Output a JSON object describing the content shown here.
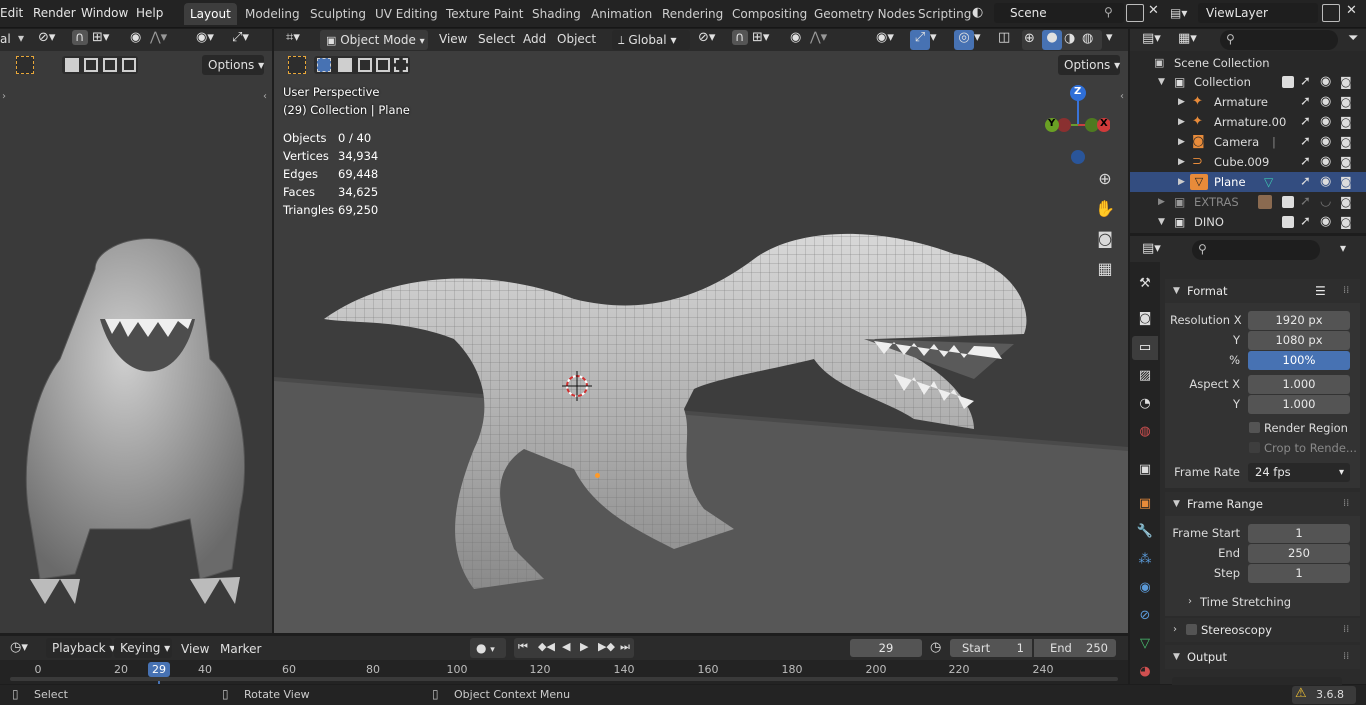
{
  "top_menu": {
    "edit": "Edit",
    "render": "Render",
    "window": "Window",
    "help": "Help"
  },
  "workspaces": [
    "Layout",
    "Modeling",
    "Sculpting",
    "UV Editing",
    "Texture Paint",
    "Shading",
    "Animation",
    "Rendering",
    "Compositing",
    "Geometry Nodes",
    "Scripting"
  ],
  "scene": {
    "name": "Scene",
    "view_layer": "ViewLayer"
  },
  "left_view": {
    "mode_frag": "al",
    "options": "Options"
  },
  "viewport": {
    "mode": "Object Mode",
    "view": "View",
    "select": "Select",
    "add": "Add",
    "object": "Object",
    "orientation": "Global",
    "options": "Options",
    "perspective": "User Perspective",
    "collection_line": "(29) Collection | Plane",
    "stats": [
      {
        "label": "Objects",
        "value": "0 / 40"
      },
      {
        "label": "Vertices",
        "value": "34,934"
      },
      {
        "label": "Edges",
        "value": "69,448"
      },
      {
        "label": "Faces",
        "value": "34,625"
      },
      {
        "label": "Triangles",
        "value": "69,250"
      }
    ],
    "gizmo": {
      "z": "Z",
      "y": "Y",
      "x": "X"
    }
  },
  "outliner": {
    "scene_collection": "Scene Collection",
    "rows": [
      {
        "name": "Collection",
        "level": 1
      },
      {
        "name": "Armature",
        "level": 2
      },
      {
        "name": "Armature.00",
        "level": 2
      },
      {
        "name": "Camera",
        "level": 2
      },
      {
        "name": "Cube.009",
        "level": 2
      },
      {
        "name": "Plane",
        "level": 2,
        "selected": true
      },
      {
        "name": "EXTRAS",
        "level": 1
      },
      {
        "name": "DINO",
        "level": 1
      }
    ]
  },
  "properties": {
    "format_title": "Format",
    "resolution_x_label": "Resolution X",
    "resolution_x": "1920 px",
    "y_label": "Y",
    "resolution_y": "1080 px",
    "pct_label": "%",
    "pct": "100%",
    "aspect_x_label": "Aspect X",
    "aspect_x": "1.000",
    "aspect_y_label": "Y",
    "aspect_y": "1.000",
    "render_region": "Render Region",
    "crop": "Crop to Rende...",
    "frame_rate_label": "Frame Rate",
    "frame_rate": "24 fps",
    "frame_range_title": "Frame Range",
    "frame_start_label": "Frame Start",
    "frame_start": "1",
    "end_label": "End",
    "end": "250",
    "step_label": "Step",
    "step": "1",
    "time_stretching": "Time Stretching",
    "stereoscopy": "Stereoscopy",
    "output": "Output"
  },
  "timeline": {
    "playback": "Playback",
    "keying": "Keying",
    "view": "View",
    "marker": "Marker",
    "current_frame": "29",
    "start_label": "Start",
    "start": "1",
    "end_label": "End",
    "end": "250",
    "ticks": [
      "0",
      "20",
      "40",
      "60",
      "80",
      "100",
      "120",
      "140",
      "160",
      "180",
      "200",
      "220",
      "240"
    ],
    "playhead": "29"
  },
  "status": {
    "select": "Select",
    "rotate": "Rotate View",
    "context": "Object Context Menu",
    "version": "3.6.8"
  },
  "colors": {
    "accent": "#4772b3",
    "selected_row": "#334d80",
    "header": "#2b2b2b",
    "viewport_bg": "#3d3d3d"
  }
}
